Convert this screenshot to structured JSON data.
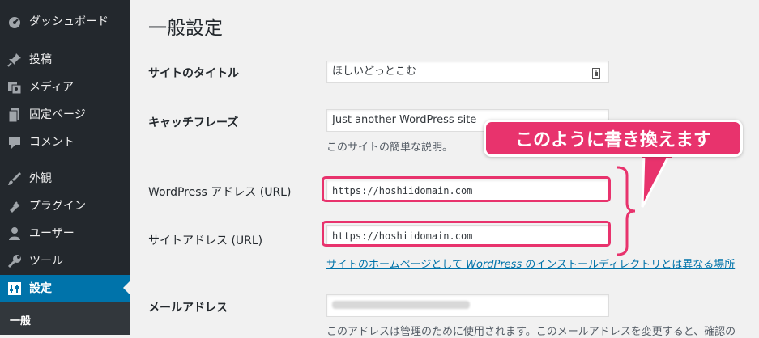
{
  "sidebar": {
    "items": [
      {
        "label": "ダッシュボード",
        "icon": "dashboard-icon"
      },
      {
        "label": "投稿",
        "icon": "pin-icon"
      },
      {
        "label": "メディア",
        "icon": "media-icon"
      },
      {
        "label": "固定ページ",
        "icon": "page-icon"
      },
      {
        "label": "コメント",
        "icon": "comment-icon"
      },
      {
        "label": "外観",
        "icon": "appearance-icon"
      },
      {
        "label": "プラグイン",
        "icon": "plugin-icon"
      },
      {
        "label": "ユーザー",
        "icon": "user-icon"
      },
      {
        "label": "ツール",
        "icon": "wrench-icon"
      },
      {
        "label": "設定",
        "icon": "settings-icon"
      }
    ],
    "current": "設定",
    "submenu": {
      "first": "一般"
    },
    "colors": {
      "bg": "#23282d",
      "current": "#0073aa"
    }
  },
  "main": {
    "title": "一般設定",
    "site_title": {
      "label": "サイトのタイトル",
      "value": "ほしいどっとこむ"
    },
    "tagline": {
      "label": "キャッチフレーズ",
      "value": "Just another WordPress site",
      "desc": "このサイトの簡単な説明。"
    },
    "wp_address": {
      "label": "WordPress アドレス (URL)",
      "value": "https://hoshiidomain.com"
    },
    "site_address": {
      "label": "サイトアドレス (URL)",
      "value": "https://hoshiidomain.com"
    },
    "site_address_link": {
      "before": "サイトのホームページとして ",
      "wp": "WordPress",
      "after": " のインストールディレクトリとは異なる場所"
    },
    "email": {
      "label": "メールアドレス",
      "desc": "このアドレスは管理のために使用されます。このメールアドレスを変更すると、確認の"
    }
  },
  "callout": {
    "text": "このように書き換えます",
    "color": "#e8336d"
  }
}
